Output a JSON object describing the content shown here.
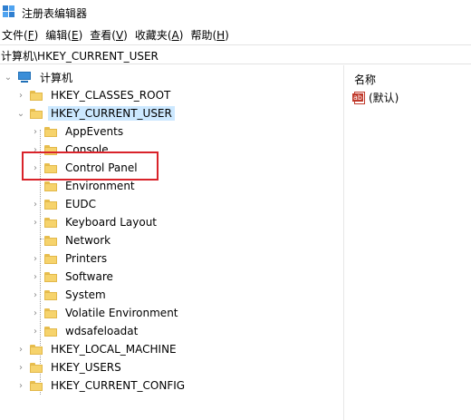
{
  "window": {
    "title": "注册表编辑器"
  },
  "menu": [
    {
      "text": "文件(",
      "key": "F",
      "end": ")"
    },
    {
      "text": "编辑(",
      "key": "E",
      "end": ")"
    },
    {
      "text": "查看(",
      "key": "V",
      "end": ")"
    },
    {
      "text": "收藏夹(",
      "key": "A",
      "end": ")"
    },
    {
      "text": "帮助(",
      "key": "H",
      "end": ")"
    }
  ],
  "address": "计算机\\HKEY_CURRENT_USER",
  "tree": {
    "root": "计算机",
    "hives_top": [
      "HKEY_CLASSES_ROOT",
      "HKEY_CURRENT_USER"
    ],
    "current_user_children": [
      "AppEvents",
      "Console",
      "Control Panel",
      "Environment",
      "EUDC",
      "Keyboard Layout",
      "Network",
      "Printers",
      "Software",
      "System",
      "Volatile Environment",
      "wdsafeloadat"
    ],
    "hives_bottom": [
      "HKEY_LOCAL_MACHINE",
      "HKEY_USERS",
      "HKEY_CURRENT_CONFIG"
    ]
  },
  "values_pane": {
    "column_name": "名称",
    "default_value": "(默认)"
  },
  "icons": {
    "app": "registry-editor-icon",
    "computer": "computer-icon",
    "folder": "folder-icon",
    "string_value": "string-value-icon"
  },
  "colors": {
    "selection": "#cce8ff",
    "highlight_box": "#d9232a",
    "folder": "#f6d36c"
  }
}
